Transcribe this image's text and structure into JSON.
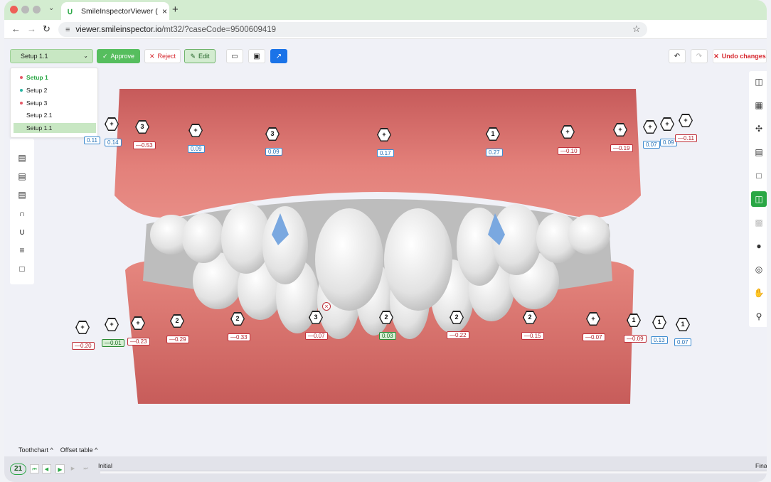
{
  "browser": {
    "tab_title": "SmileInspectorViewer (v1.0.1",
    "url_host": "viewer.smileinspector.io",
    "url_path": "/mt32/?caseCode=9500609419"
  },
  "toolbar": {
    "setup_selected": "Setup 1.1",
    "approve_label": "Approve",
    "reject_label": "Reject",
    "edit_label": "Edit",
    "undo_changes_label": "Undo changes"
  },
  "setup_menu": [
    {
      "label": "Setup 1",
      "dot": "#e45a68",
      "active": true
    },
    {
      "label": "Setup 2",
      "dot": "#2bb5a3"
    },
    {
      "label": "Setup 3",
      "dot": "#e45a68"
    },
    {
      "label": "Setup 2.1",
      "dot": ""
    },
    {
      "label": "Setup 1.1",
      "dot": "",
      "selected": true
    }
  ],
  "upper_annotations": [
    {
      "hex": "+",
      "value": "0.11",
      "color": "blue"
    },
    {
      "hex": "+",
      "value": "0.14",
      "color": "blue"
    },
    {
      "hex": "3",
      "value": "—0.53",
      "color": "red"
    },
    {
      "hex": "+",
      "value": "0.09",
      "color": "blue"
    },
    {
      "hex": "3",
      "value": "0.09",
      "color": "blue"
    },
    {
      "hex": "+",
      "value": "0.17",
      "color": "blue"
    },
    {
      "hex": "1",
      "value": "0.27",
      "color": "blue"
    },
    {
      "hex": "+",
      "value": "—0.10",
      "color": "red"
    },
    {
      "hex": "+",
      "value": "—0.19",
      "color": "red"
    },
    {
      "hex": "+",
      "value": "0.07",
      "color": "blue"
    },
    {
      "hex": "+",
      "value": "0.09",
      "color": "blue"
    },
    {
      "hex": "+",
      "value": "—0.11",
      "color": "red"
    }
  ],
  "lower_annotations": [
    {
      "hex": "+",
      "value": "—0.20",
      "color": "red"
    },
    {
      "hex": "+",
      "value": "—0.01",
      "color": "green"
    },
    {
      "hex": "+",
      "value": "—0.23",
      "color": "red"
    },
    {
      "hex": "2",
      "value": "—0.29",
      "color": "red"
    },
    {
      "hex": "2",
      "value": "—0.33",
      "color": "red"
    },
    {
      "hex": "3",
      "value": "—0.07",
      "color": "red"
    },
    {
      "hex": "2",
      "value": "0.03",
      "color": "green"
    },
    {
      "hex": "2",
      "value": "—0.22",
      "color": "red"
    },
    {
      "hex": "2",
      "value": "—0.15",
      "color": "red"
    },
    {
      "hex": "+",
      "value": "—0.07",
      "color": "red"
    },
    {
      "hex": "1",
      "value": "—0.09",
      "color": "red"
    },
    {
      "hex": "1",
      "value": "0.13",
      "color": "blue"
    },
    {
      "hex": "1",
      "value": "0.07",
      "color": "blue"
    }
  ],
  "bottom": {
    "toothchart_tab": "Toothchart",
    "offset_tab": "Offset table",
    "current_step": "21",
    "start_label": "Initial",
    "end_label": "Fina"
  },
  "colors": {
    "accent_green": "#2aa745",
    "reject_red": "#d6262d",
    "gum": "#d36b68",
    "tooth": "#e9e9e9",
    "ipr_blue": "#7aa8e0"
  }
}
